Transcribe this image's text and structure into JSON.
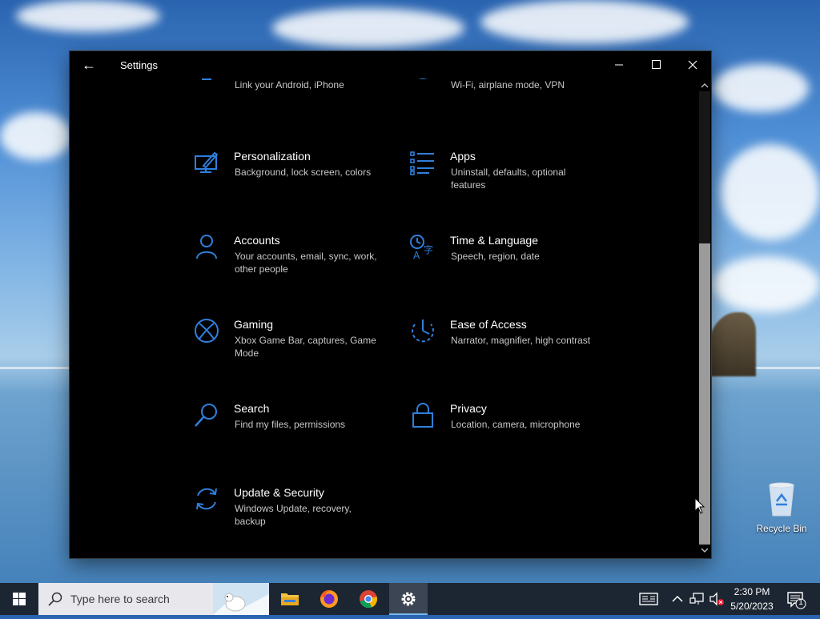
{
  "window": {
    "title": "Settings",
    "back_glyph": "←"
  },
  "settings_items": [
    {
      "key": "phone",
      "label": "",
      "desc": "Link your Android, iPhone",
      "icon": "phone-icon"
    },
    {
      "key": "network",
      "label": "",
      "desc": "Wi-Fi, airplane mode, VPN",
      "icon": "globe-icon"
    },
    {
      "key": "personalization",
      "label": "Personalization",
      "desc": "Background, lock screen, colors",
      "icon": "paint-monitor-icon"
    },
    {
      "key": "apps",
      "label": "Apps",
      "desc": "Uninstall, defaults, optional features",
      "icon": "apps-list-icon"
    },
    {
      "key": "accounts",
      "label": "Accounts",
      "desc": "Your accounts, email, sync, work, other people",
      "icon": "person-icon"
    },
    {
      "key": "time-language",
      "label": "Time & Language",
      "desc": "Speech, region, date",
      "icon": "time-language-icon"
    },
    {
      "key": "gaming",
      "label": "Gaming",
      "desc": "Xbox Game Bar, captures, Game Mode",
      "icon": "xbox-icon"
    },
    {
      "key": "ease-of-access",
      "label": "Ease of Access",
      "desc": "Narrator, magnifier, high contrast",
      "icon": "ease-of-access-icon"
    },
    {
      "key": "search",
      "label": "Search",
      "desc": "Find my files, permissions",
      "icon": "search-icon"
    },
    {
      "key": "privacy",
      "label": "Privacy",
      "desc": "Location, camera, microphone",
      "icon": "lock-icon"
    },
    {
      "key": "update-security",
      "label": "Update & Security",
      "desc": "Windows Update, recovery, backup",
      "icon": "sync-arrows-icon"
    }
  ],
  "desktop": {
    "recycle_bin_label": "Recycle Bin"
  },
  "taskbar": {
    "search_placeholder": "Type here to search",
    "time": "2:30 PM",
    "date": "5/20/2023",
    "notification_count": "1"
  },
  "colors": {
    "accent": "#2f7fdc",
    "window_bg": "#000000",
    "taskbar_bg": "#1c2632"
  }
}
